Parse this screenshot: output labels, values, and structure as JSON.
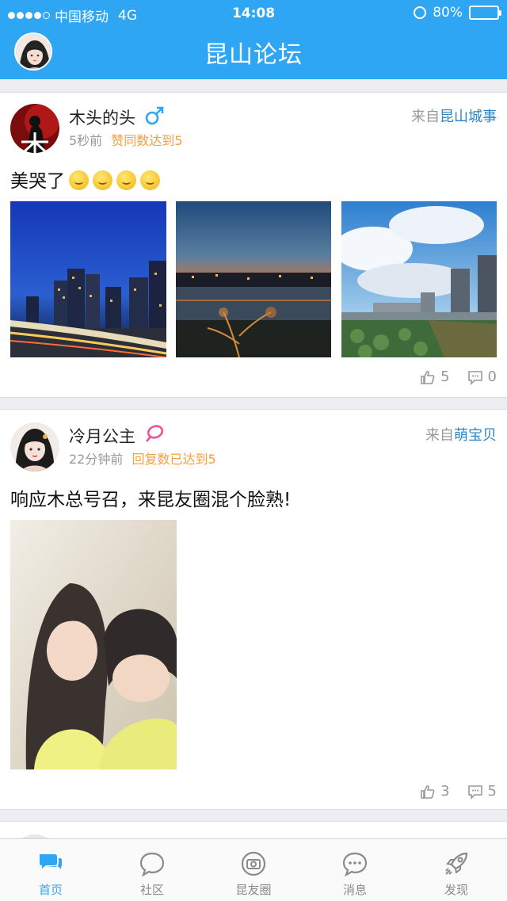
{
  "status_bar": {
    "carrier": "中国移动",
    "network": "4G",
    "time": "14:08",
    "battery": "80%",
    "battery_level": 0.8
  },
  "header": {
    "title": "昆山论坛"
  },
  "posts": [
    {
      "username": "木头的头",
      "gender_icon": "male-icon",
      "time": "5秒前",
      "badge": "赞同数达到5",
      "source_prefix": "来自",
      "source": "昆山城事",
      "text": "美哭了",
      "emoji_count": 4,
      "likes": "5",
      "comments": "0"
    },
    {
      "username": "冷月公主",
      "gender_icon": "female-icon",
      "time": "22分钟前",
      "badge": "回复数已达到5",
      "source_prefix": "来自",
      "source": "萌宝贝",
      "text": "响应木总号召，来昆友圈混个脸熟!",
      "likes": "3",
      "comments": "5"
    }
  ],
  "tabs": [
    {
      "label": "首页",
      "icon": "chat-bubbles-icon",
      "active": true
    },
    {
      "label": "社区",
      "icon": "speech-bubble-icon",
      "active": false
    },
    {
      "label": "昆友圈",
      "icon": "camera-circle-icon",
      "active": false
    },
    {
      "label": "消息",
      "icon": "message-dots-icon",
      "active": false
    },
    {
      "label": "发现",
      "icon": "rocket-icon",
      "active": false
    }
  ],
  "colors": {
    "brand": "#2ea6f3",
    "badge": "#f4a03c",
    "source_link": "#2a86c8"
  }
}
